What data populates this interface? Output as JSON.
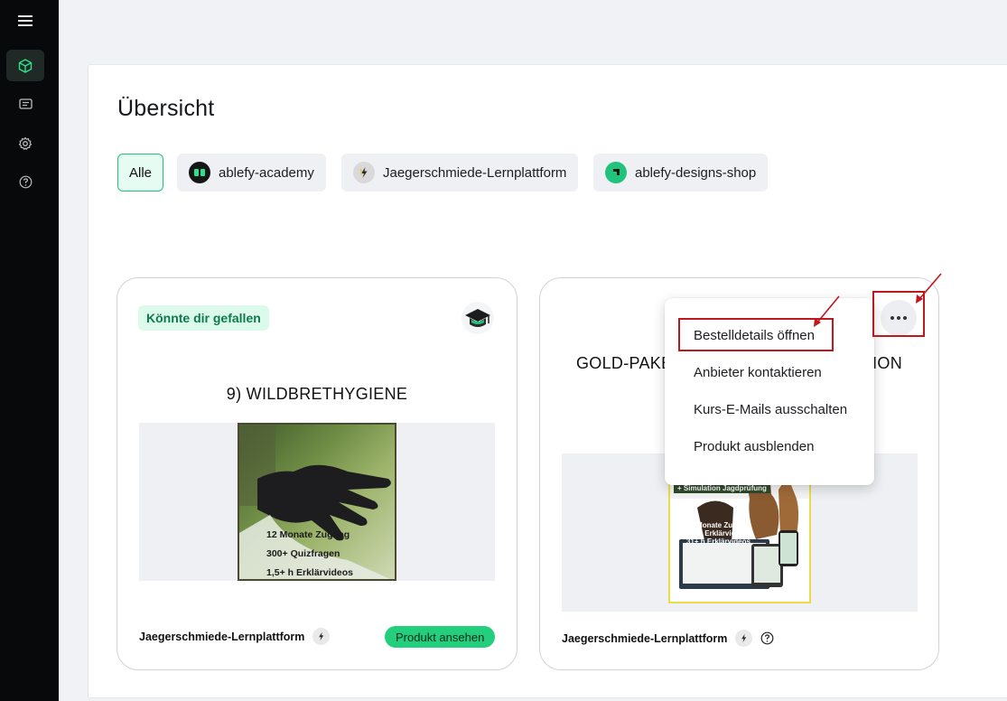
{
  "page": {
    "title": "Übersicht"
  },
  "sidebar": {
    "items": [
      {
        "icon": "menu-icon"
      },
      {
        "icon": "box-icon",
        "active": true
      },
      {
        "icon": "message-icon"
      },
      {
        "icon": "gear-icon"
      },
      {
        "icon": "help-icon"
      }
    ]
  },
  "filters": [
    {
      "label": "Alle",
      "active": true
    },
    {
      "label": "ablefy-academy",
      "icon": "ablefy-academy-logo",
      "color": "#161616"
    },
    {
      "label": "Jaegerschmiede-Lernplattform",
      "icon": "jaegerschmiede-logo",
      "color": "#d9d9d9"
    },
    {
      "label": "ablefy-designs-shop",
      "icon": "ablefy-designs-logo",
      "color": "#21c27c"
    }
  ],
  "cards": [
    {
      "badge": "Könnte dir gefallen",
      "title": "9) WILDBRETHYGIENE",
      "image_lines": [
        "12 Monate Zugang",
        "300+ Quizfragen",
        "1,5+ h Erklärvideos"
      ],
      "provider": "Jaegerschmiede-Lernplattform",
      "button": "Produkt ansehen"
    },
    {
      "title_left": "GOLD-PAKE",
      "title_right": "ION",
      "image_banner": "+ Simulation Jagdprüfung",
      "image_lines": [
        "12 Monate Zugang",
        "350+ Erklärvideos",
        "31+ h Erklärvideos"
      ],
      "provider": "Jaegerschmiede-Lernplattform"
    }
  ],
  "menu": {
    "items": [
      "Bestelldetails öffnen",
      "Anbieter kontaktieren",
      "Kurs-E-Mails ausschalten",
      "Produkt ausblenden"
    ]
  },
  "colors": {
    "accent": "#21c27c",
    "sidebar": "#08090b",
    "annotation": "#c0161d"
  }
}
